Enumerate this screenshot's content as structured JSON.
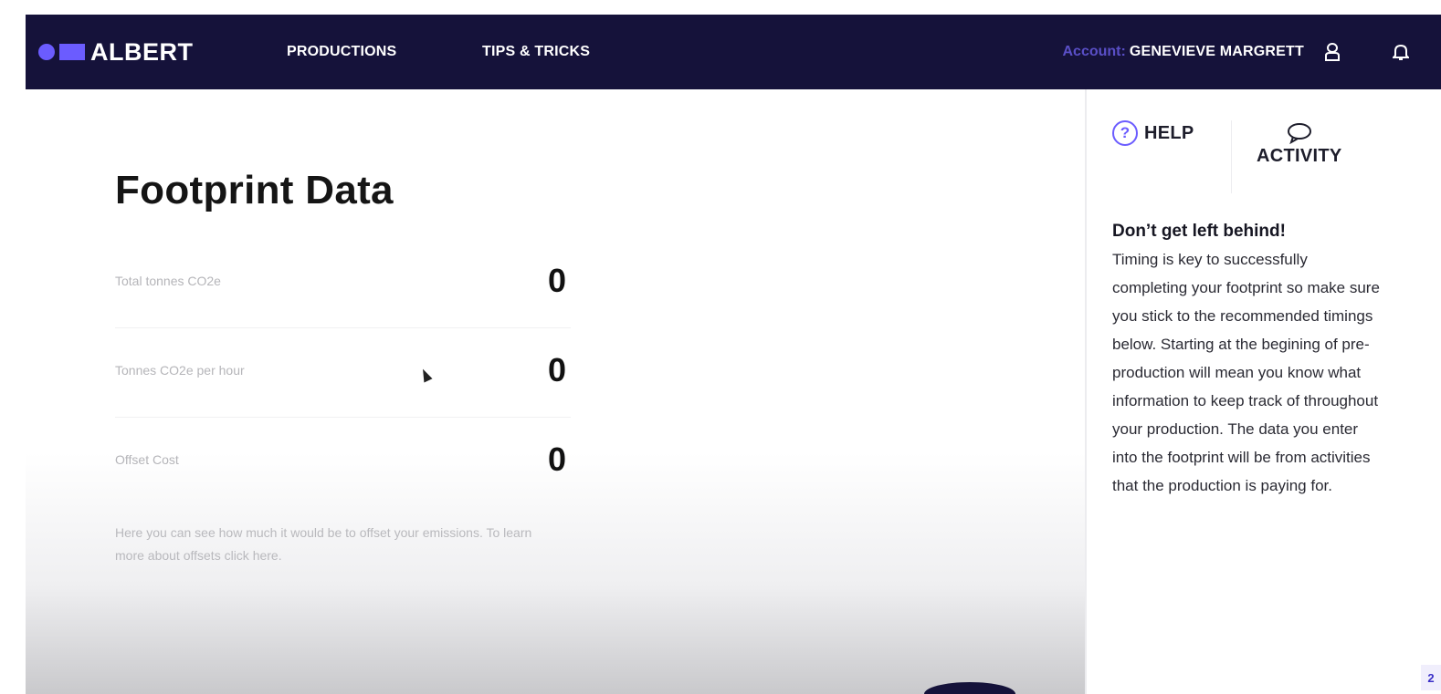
{
  "nav": {
    "brand": "ALBERT",
    "links": [
      "PRODUCTIONS",
      "TIPS & TRICKS"
    ],
    "account_label": "Account:",
    "account_name": "GENEVIEVE MARGRETT",
    "icons": [
      "user-icon",
      "bell-icon"
    ]
  },
  "main": {
    "title": "Footprint Data",
    "stats": [
      {
        "label": "Total tonnes CO2e",
        "value": "0"
      },
      {
        "label": "Tonnes CO2e per hour",
        "value": "0"
      },
      {
        "label": "Offset Cost",
        "value": "0"
      }
    ],
    "offset_note": "Here you can see how much it would be to offset your emissions. To learn more about offsets click here."
  },
  "side_panel": {
    "tabs": [
      {
        "label": "HELP",
        "icon": "help-icon"
      },
      {
        "label": "ACTIVITY",
        "icon": "chat-bubble-icon"
      }
    ],
    "heading": "Don’t get left behind!",
    "body": "Timing is key to successfully completing your footprint so make sure you stick to the recommended timings below. Starting at the begining of pre-production will mean you know what information to keep track of throughout your production. The data you enter into the footprint will be from activities that the production is paying for.",
    "corner_badge": "2"
  },
  "colors": {
    "nav_bg": "#15123a",
    "accent": "#6b5cff",
    "account_label": "#5a4fc7"
  }
}
